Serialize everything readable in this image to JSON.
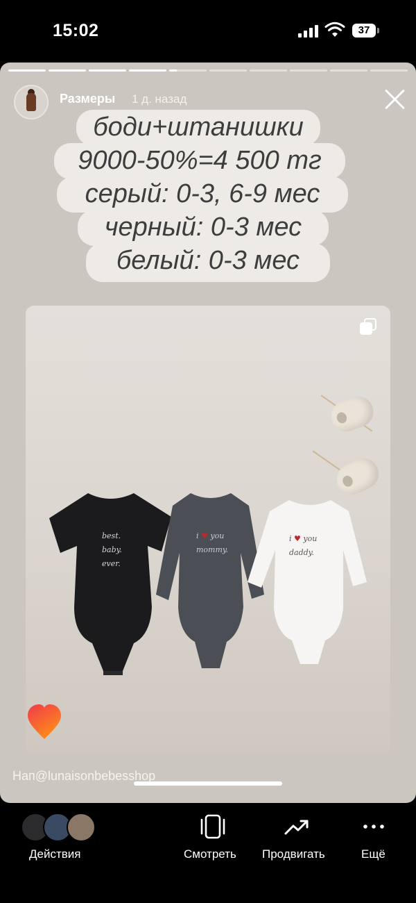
{
  "status_bar": {
    "time": "15:02",
    "battery": "37"
  },
  "story": {
    "user_name": "Размеры",
    "posted_ago": "1 д. назад",
    "progress": {
      "total_segments": 10,
      "completed_segments": 4,
      "current_segment_fraction": 0.2
    },
    "caption_lines": [
      "боди+штанишки",
      "9000-50%=4 500 тг",
      "серый: 0-3, 6-9 мес",
      "черный: 0-3 мес",
      "белый: 0-3 мес"
    ],
    "photo": {
      "black_print": "best.\nbaby.\never.",
      "gray_print": "i ♥ you\nmommy.",
      "white_print": "i ♥ you\ndaddy."
    },
    "mention": "Нап@lunaisonbebesshop"
  },
  "actions": {
    "activity_label": "Действия",
    "view_label": "Смотреть",
    "promote_label": "Продвигать",
    "more_label": "Ещё"
  },
  "colors": {
    "story_bg": "#cbc6c0",
    "caption_bg": "#eeebe7",
    "caption_text": "#3d3d3d",
    "print_red": "#c0262e"
  }
}
